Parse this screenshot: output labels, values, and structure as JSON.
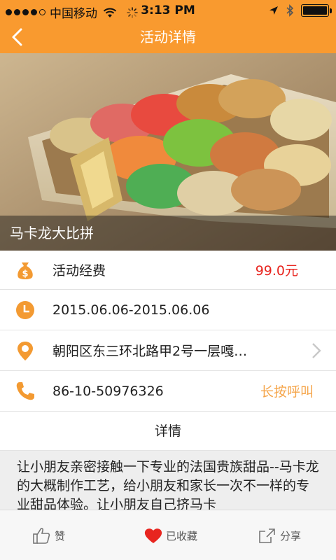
{
  "status_bar": {
    "signal_filled": 4,
    "signal_total": 5,
    "carrier": "中国移动",
    "time": "3:13 PM"
  },
  "nav": {
    "title": "活动详情"
  },
  "hero": {
    "title": "马卡龙大比拼"
  },
  "info": {
    "fee_label": "活动经费",
    "fee_value": "99.0元",
    "date_range": "2015.06.06-2015.06.06",
    "address": "朝阳区东三环北路甲2号一层嘎…",
    "phone": "86-10-50976326",
    "call_action": "长按呼叫"
  },
  "details": {
    "heading": "详情",
    "text": "让小朋友亲密接触一下专业的法国贵族甜品--马卡龙的大概制作工艺，给小朋友和家长一次不一样的专业甜品体验。让小朋友自己挤马卡"
  },
  "tabbar": {
    "like_label": "赞",
    "favorite_label": "已收藏",
    "share_label": "分享"
  },
  "colors": {
    "brand_orange": "#f99a2f",
    "price_red": "#e8251f",
    "call_orange": "#f5a54a",
    "heart_red": "#e8251f"
  },
  "icons": [
    "back-icon",
    "money-bag-icon",
    "clock-icon",
    "location-pin-icon",
    "phone-icon",
    "chevron-right-icon",
    "thumbs-up-icon",
    "heart-icon",
    "share-icon"
  ]
}
